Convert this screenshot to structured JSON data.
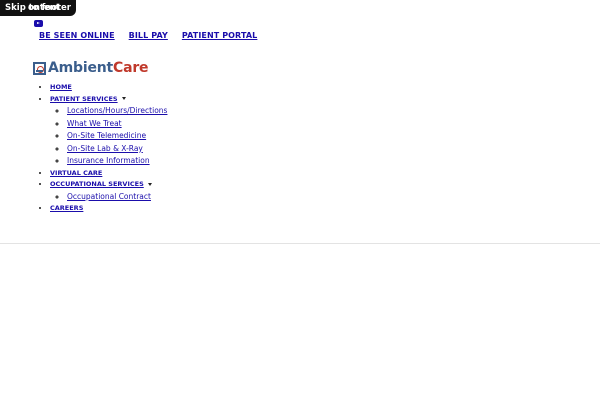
{
  "skip_link": {
    "primary": "Skip to footer",
    "overlap": "ontent"
  },
  "social": {
    "youtube_icon": "youtube-icon"
  },
  "top_links": [
    {
      "label": "BE SEEN ONLINE"
    },
    {
      "label": "BILL PAY"
    },
    {
      "label": "PATIENT PORTAL"
    }
  ],
  "logo": {
    "part1": "Ambient",
    "part2": "Care"
  },
  "nav": {
    "home": "HOME",
    "patient_services": "PATIENT SERVICES",
    "patient_sub": [
      "Locations/Hours/Directions",
      "What We Treat",
      "On-Site Telemedicine",
      "On-Site Lab & X-Ray",
      "Insurance Information"
    ],
    "virtual_care": "VIRTUAL CARE",
    "occupational_services": "OCCUPATIONAL SERVICES",
    "occupational_sub": [
      "Occupational Contract"
    ],
    "careers": "CAREERS"
  },
  "colors": {
    "link": "#1a0dab",
    "brand_blue": "#3b5e8c",
    "brand_red": "#c0392b"
  }
}
